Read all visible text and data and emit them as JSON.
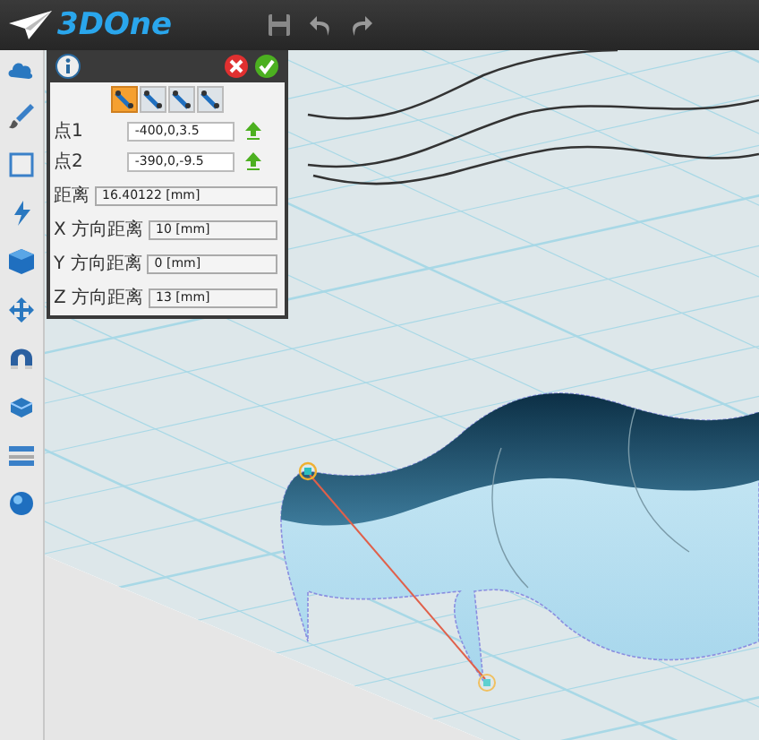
{
  "app": {
    "logo": "3DOne"
  },
  "dialog": {
    "modes": [
      {
        "selected": true
      },
      {
        "selected": false
      },
      {
        "selected": false
      },
      {
        "selected": false
      }
    ],
    "fields": [
      {
        "kind": "point",
        "label": "点1",
        "value": "-400,0,3.5"
      },
      {
        "kind": "point",
        "label": "点2",
        "value": "-390,0,-9.5"
      },
      {
        "kind": "readout",
        "label": "距离",
        "value": "16.40122  [mm]"
      },
      {
        "kind": "readout",
        "label": "X 方向距离",
        "value": "10  [mm]"
      },
      {
        "kind": "readout",
        "label": "Y 方向距离",
        "value": "0  [mm]"
      },
      {
        "kind": "readout",
        "label": "Z 方向距离",
        "value": "13  [mm]"
      }
    ]
  }
}
